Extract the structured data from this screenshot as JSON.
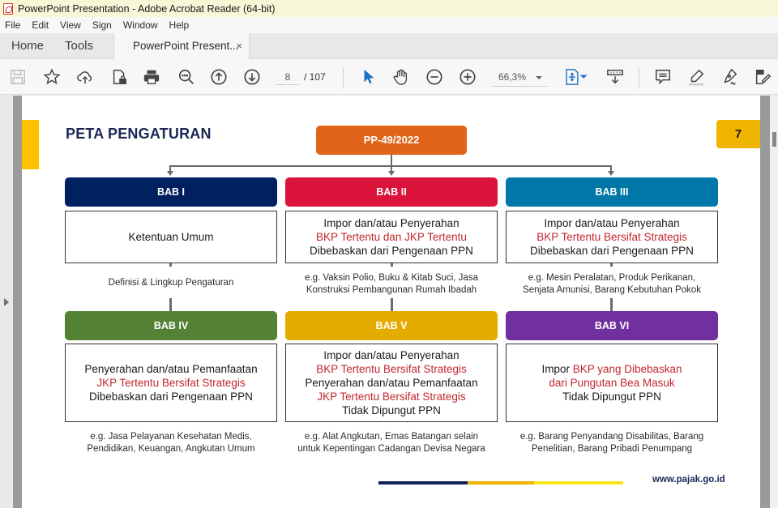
{
  "window": {
    "title": "PowerPoint Presentation - Adobe Acrobat Reader (64-bit)"
  },
  "menu": [
    "File",
    "Edit",
    "View",
    "Sign",
    "Window",
    "Help"
  ],
  "tabs": {
    "home": "Home",
    "tools": "Tools",
    "document": "PowerPoint Present...",
    "close": "×"
  },
  "toolbar": {
    "icons": [
      "save-icon",
      "bookmark-star-icon",
      "upload-cloud-icon",
      "protect-file-icon",
      "print-icon",
      "find-zoom-icon",
      "previous-page-icon",
      "next-page-icon",
      "select-cursor-icon",
      "hand-tool-icon",
      "zoom-out-icon",
      "zoom-in-icon",
      "fit-page-icon",
      "scrolling-mode-icon",
      "comment-icon",
      "highlight-icon",
      "sign-icon",
      "fill-sign-icon"
    ],
    "current_page": "8",
    "page_total": "/  107",
    "zoom_level": "66,3%"
  },
  "slide": {
    "title": "PETA PENGATURAN",
    "page_number": "7",
    "root": "PP-49/2022",
    "footer_url": "www.pajak.go.id",
    "colors": {
      "root": "#e0651a",
      "accent": "#ffc000",
      "highlight_text": "#c1272d",
      "footer_navy": "#0f2557",
      "footer_orange": "#efb300",
      "footer_yellow": "#f5e61a"
    },
    "babs": [
      {
        "label": "BAB I",
        "color": "#002060",
        "lines": [
          {
            "text": "Ketentuan Umum",
            "red": false
          }
        ],
        "example": [
          "Definisi & Lingkup Pengaturan"
        ]
      },
      {
        "label": "BAB II",
        "color": "#dc143c",
        "lines": [
          {
            "text": "Impor dan/atau Penyerahan",
            "red": false
          },
          {
            "text": "BKP Tertentu dan JKP Tertentu",
            "red": true
          },
          {
            "text": "Dibebaskan dari Pengenaan PPN",
            "red": false
          }
        ],
        "example": [
          "e.g. Vaksin Polio, Buku & Kitab Suci, Jasa",
          "Konstruksi Pembangunan Rumah Ibadah"
        ]
      },
      {
        "label": "BAB III",
        "color": "#0077a6",
        "lines": [
          {
            "text": "Impor dan/atau Penyerahan",
            "red": false
          },
          {
            "text": "BKP Tertentu Bersifat Strategis",
            "red": true
          },
          {
            "text": "Dibebaskan dari Pengenaan PPN",
            "red": false
          }
        ],
        "example": [
          "e.g. Mesin Peralatan, Produk Perikanan,",
          "Senjata Amunisi, Barang Kebutuhan Pokok"
        ]
      },
      {
        "label": "BAB IV",
        "color": "#548235",
        "lines": [
          {
            "text": "Penyerahan dan/atau Pemanfaatan",
            "red": false
          },
          {
            "text": "JKP Tertentu Bersifat Strategis",
            "red": true
          },
          {
            "text": "Dibebaskan dari Pengenaan PPN",
            "red": false
          }
        ],
        "example": [
          "e.g. Jasa Pelayanan Kesehatan Medis,",
          "Pendidikan, Keuangan, Angkutan Umum"
        ]
      },
      {
        "label": "BAB V",
        "color": "#e5ac00",
        "lines": [
          {
            "text": "Impor dan/atau Penyerahan",
            "red": false
          },
          {
            "text": "BKP Tertentu Bersifat Strategis",
            "red": true
          },
          {
            "text": "Penyerahan dan/atau Pemanfaatan",
            "red": false
          },
          {
            "text": "JKP Tertentu Bersifat Strategis",
            "red": true
          },
          {
            "text": "Tidak Dipungut PPN",
            "red": false
          }
        ],
        "example": [
          "e.g. Alat Angkutan, Emas Batangan selain",
          "untuk Kepentingan Cadangan Devisa Negara"
        ]
      },
      {
        "label": "BAB VI",
        "color": "#7030a0",
        "lines": [
          {
            "segments": [
              {
                "text": "Impor ",
                "red": false
              },
              {
                "text": "BKP yang Dibebaskan",
                "red": true
              }
            ]
          },
          {
            "text": "dari Pungutan Bea Masuk",
            "red": true
          },
          {
            "text": "Tidak Dipungut PPN",
            "red": false
          }
        ],
        "example": [
          "e.g. Barang Penyandang Disabilitas, Barang",
          "Penelitian, Barang Pribadi Penumpang"
        ]
      }
    ]
  }
}
